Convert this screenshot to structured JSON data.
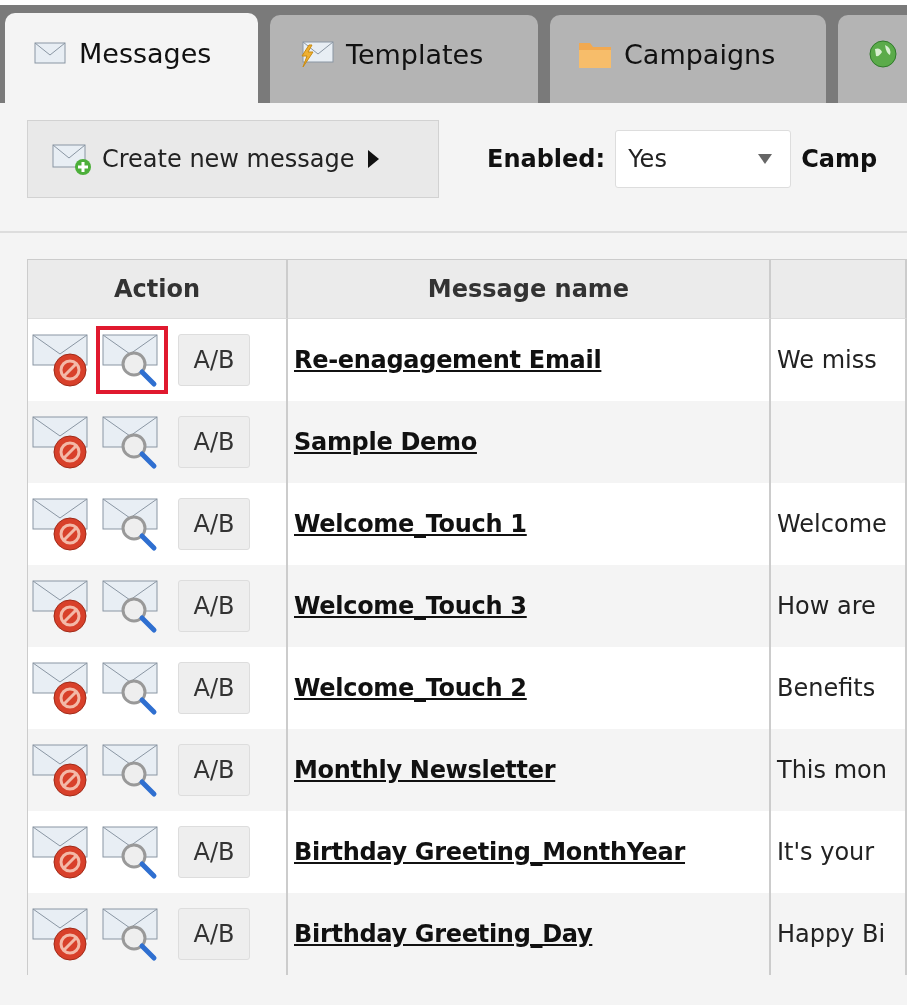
{
  "tabs": [
    {
      "label": "Messages",
      "selected": true
    },
    {
      "label": "Templates",
      "selected": false
    },
    {
      "label": "Campaigns",
      "selected": false
    },
    {
      "selected": false
    }
  ],
  "toolbar": {
    "create_button": "Create new message",
    "filters": [
      {
        "label": "Enabled:",
        "value": "Yes"
      },
      {
        "label": "Camp"
      }
    ]
  },
  "table": {
    "columns": [
      "Action",
      "Message name"
    ],
    "rows": [
      {
        "name": "Re-enagagement Email",
        "column_3": "We miss",
        "ab": "A/B",
        "highlighted": true
      },
      {
        "name": "Sample Demo",
        "ab": "A/B",
        "highlighted": false
      },
      {
        "name": "Welcome_Touch 1",
        "column_3": "Welcome",
        "ab": "A/B",
        "highlighted": false
      },
      {
        "name": "Welcome_Touch 3",
        "column_3": "How are",
        "ab": "A/B",
        "highlighted": false
      },
      {
        "name": "Welcome_Touch 2",
        "column_3": "Benefits",
        "ab": "A/B",
        "highlighted": false
      },
      {
        "name": "Monthly Newsletter",
        "column_3": "This mon",
        "ab": "A/B",
        "highlighted": false
      },
      {
        "name": "Birthday Greeting_MonthYear",
        "column_3": "It's your",
        "ab": "A/B",
        "highlighted": false
      },
      {
        "name": "Birthday Greeting_Day",
        "column_3": "Happy Bi",
        "ab": "A/B",
        "highlighted": false
      }
    ]
  }
}
